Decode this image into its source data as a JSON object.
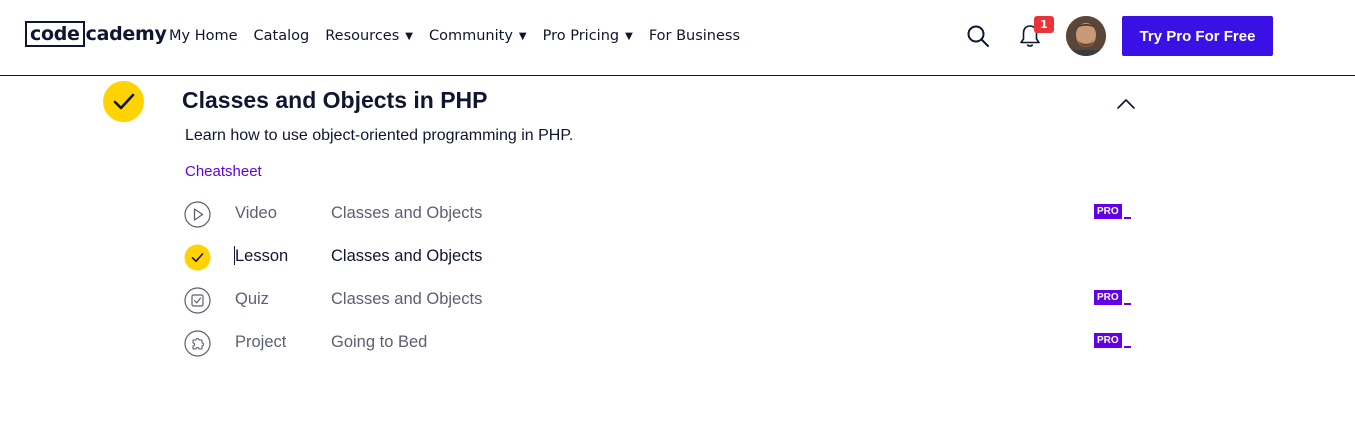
{
  "header": {
    "logo": {
      "boxed": "code",
      "rest": "cademy"
    },
    "nav": [
      {
        "label": "My Home",
        "dropdown": false
      },
      {
        "label": "Catalog",
        "dropdown": false
      },
      {
        "label": "Resources",
        "dropdown": true
      },
      {
        "label": "Community",
        "dropdown": true
      },
      {
        "label": "Pro Pricing",
        "dropdown": true
      },
      {
        "label": "For Business",
        "dropdown": false
      }
    ],
    "notification_count": "1",
    "cta_label": "Try Pro For Free"
  },
  "module": {
    "title": "Classes and Objects in PHP",
    "description": "Learn how to use object-oriented programming in PHP.",
    "cheatsheet_label": "Cheatsheet",
    "completed": true,
    "items": [
      {
        "kind": "Video",
        "name": "Classes and Objects",
        "icon": "play-icon",
        "pro": true,
        "pro_label": "PRO"
      },
      {
        "kind": "Lesson",
        "name": "Classes and Objects",
        "icon": "check-icon",
        "pro": false
      },
      {
        "kind": "Quiz",
        "name": "Classes and Objects",
        "icon": "quiz-icon",
        "pro": true,
        "pro_label": "PRO"
      },
      {
        "kind": "Project",
        "name": "Going to Bed",
        "icon": "puzzle-icon",
        "pro": true,
        "pro_label": "PRO"
      }
    ]
  },
  "colors": {
    "brand_navy": "#10162f",
    "cta_blue": "#3a10e5",
    "pro_purple": "#6400e4",
    "check_yellow": "#ffd300",
    "badge_red": "#e9353a"
  }
}
